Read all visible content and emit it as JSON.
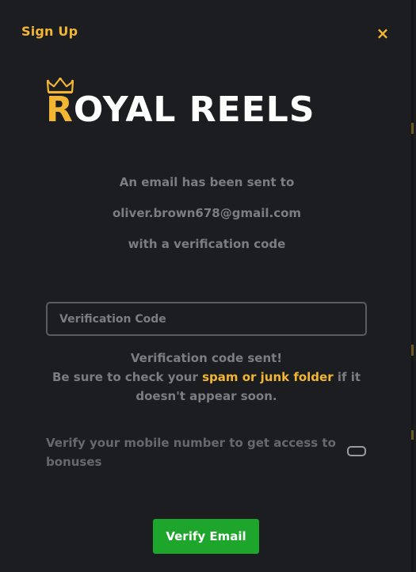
{
  "modal": {
    "title": "Sign Up",
    "close_icon": "close-icon",
    "close_glyph": "×"
  },
  "logo": {
    "first_letter": "R",
    "rest": "OYAL REELS",
    "accent_color": "#f2b632",
    "icon": "crown-icon"
  },
  "message": {
    "line1": "An email has been sent to",
    "email": "oliver.brown678@gmail.com",
    "line3": "with a verification code"
  },
  "verification": {
    "placeholder": "Verification Code",
    "value": ""
  },
  "info": {
    "sent": "Verification code sent!",
    "check_prefix": "Be sure to check your ",
    "spam_link": "spam or junk folder",
    "check_suffix": " if it doesn't appear soon."
  },
  "mobile": {
    "label": "Verify your mobile number to get access to bonuses",
    "toggle_on": false
  },
  "actions": {
    "verify_label": "Verify Email"
  },
  "colors": {
    "background": "#1c1d21",
    "accent": "#f2b632",
    "primary_button": "#1ea62c",
    "muted_text": "#7c7d83"
  }
}
